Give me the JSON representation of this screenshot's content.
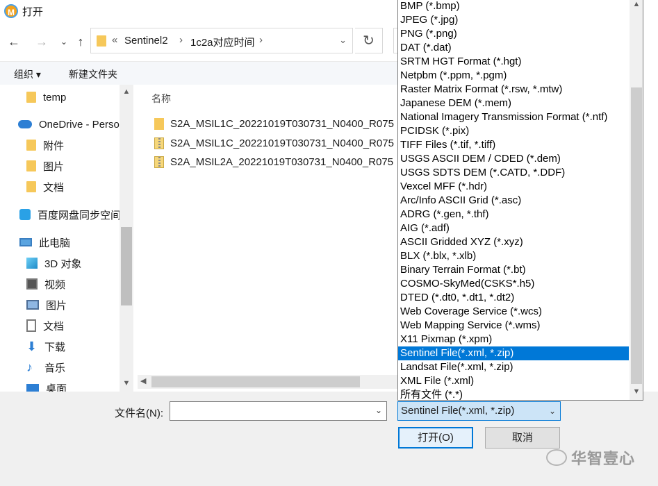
{
  "window": {
    "title": "打开"
  },
  "nav": {
    "path": [
      "Sentinel2",
      "1c2a对应时间"
    ]
  },
  "toolbar": {
    "organize": "组织",
    "new_folder": "新建文件夹"
  },
  "sidebar": {
    "items": [
      {
        "label": "temp",
        "icon": "folder-icon"
      },
      {
        "label": "OneDrive - Perso",
        "icon": "onedrive-icon"
      },
      {
        "label": "附件",
        "icon": "folder-icon"
      },
      {
        "label": "图片",
        "icon": "folder-icon"
      },
      {
        "label": "文档",
        "icon": "folder-icon"
      },
      {
        "label": "百度网盘同步空间",
        "icon": "baidu-netdisk-icon"
      },
      {
        "label": "此电脑",
        "icon": "this-pc-icon"
      },
      {
        "label": "3D 对象",
        "icon": "3d-objects-icon"
      },
      {
        "label": "视频",
        "icon": "video-icon"
      },
      {
        "label": "图片",
        "icon": "pictures-icon"
      },
      {
        "label": "文档",
        "icon": "documents-icon"
      },
      {
        "label": "下载",
        "icon": "download-icon"
      },
      {
        "label": "音乐",
        "icon": "music-icon"
      },
      {
        "label": "桌面",
        "icon": "desktop-icon"
      }
    ]
  },
  "files": {
    "column_name": "名称",
    "rows": [
      {
        "name": "S2A_MSIL1C_20221019T030731_N0400_R075",
        "type": "folder"
      },
      {
        "name": "S2A_MSIL1C_20221019T030731_N0400_R075",
        "type": "zip"
      },
      {
        "name": "S2A_MSIL2A_20221019T030731_N0400_R075",
        "type": "zip"
      }
    ]
  },
  "bottom": {
    "filename_label": "文件名(N):",
    "filename_value": "",
    "filetype_value": "Sentinel File(*.xml, *.zip)",
    "open_button": "打开(O)",
    "cancel_button": "取消"
  },
  "filetype_options": [
    "BMP (*.bmp)",
    "JPEG (*.jpg)",
    "PNG (*.png)",
    "DAT (*.dat)",
    "SRTM HGT Format (*.hgt)",
    "Netpbm (*.ppm, *.pgm)",
    "Raster Matrix Format (*.rsw, *.mtw)",
    "Japanese DEM (*.mem)",
    "National Imagery Transmission Format (*.ntf)",
    "PCIDSK (*.pix)",
    "TIFF Files (*.tif, *.tiff)",
    "USGS ASCII DEM / CDED (*.dem)",
    "USGS SDTS DEM (*.CATD, *.DDF)",
    "Vexcel MFF (*.hdr)",
    "Arc/Info ASCII Grid (*.asc)",
    "ADRG (*.gen, *.thf)",
    "AIG (*.adf)",
    "ASCII Gridded XYZ (*.xyz)",
    "BLX (*.blx, *.xlb)",
    "Binary Terrain Format (*.bt)",
    "COSMO-SkyMed(CSKS*.h5)",
    "DTED (*.dt0, *.dt1, *.dt2)",
    "Web Coverage Service (*.wcs)",
    "Web Mapping Service (*.wms)",
    "X11 Pixmap (*.xpm)",
    "Sentinel File(*.xml, *.zip)",
    "Landsat File(*.xml, *.zip)",
    "XML File (*.xml)",
    "所有文件 (*.*)"
  ],
  "selected_filetype_index": 25,
  "watermark": "华智壹心",
  "colors": {
    "selection": "#0078d7",
    "folder": "#f6c85a"
  }
}
